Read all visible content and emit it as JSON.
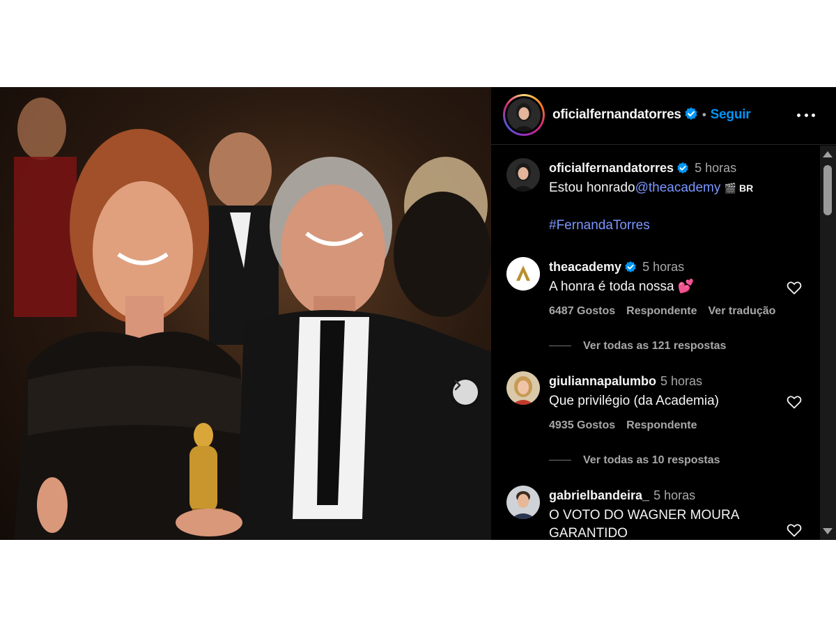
{
  "post": {
    "username": "oficialfernandatorres",
    "follow_label": "Seguir",
    "separator": "•"
  },
  "comments": [
    {
      "username": "oficialfernandatorres",
      "time": "5 horas",
      "text_prefix": "Estou honrado",
      "mention": "@theacademy",
      "flag": "🎬 BR",
      "hashtag": "#FernandaTorres"
    },
    {
      "username": "theacademy",
      "time": "5 horas",
      "text": "A honra é toda nossa 💕",
      "likes": "6487 Gostos",
      "reply_label": "Respondente",
      "translate_label": "Ver tradução",
      "view_replies": "Ver todas as 121 respostas"
    },
    {
      "username": "giuliannapalumbo",
      "time": "5 horas",
      "text": "Que privilégio (da Academia)",
      "likes": "4935 Gostos",
      "reply_label": "Respondente",
      "view_replies": "Ver todas as 10 respostas"
    },
    {
      "username": "gabrielbandeira_",
      "time": "5 horas",
      "text": "O VOTO DO WAGNER MOURA GARANTIDO"
    }
  ],
  "colors": {
    "link": "#7b96ff",
    "follow": "#0095f6",
    "verified": "#0095f6"
  }
}
